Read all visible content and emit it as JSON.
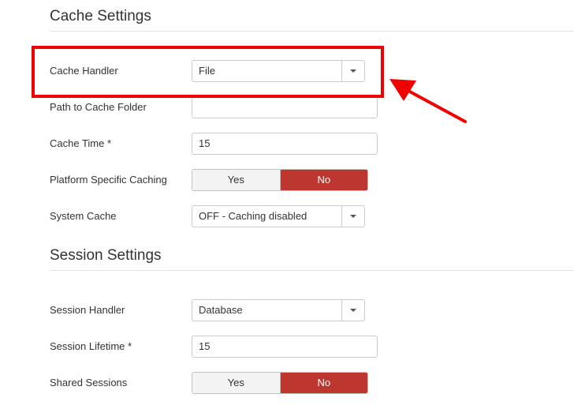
{
  "cache_section": {
    "title": "Cache Settings",
    "fields": {
      "handler": {
        "label": "Cache Handler",
        "value": "File"
      },
      "path": {
        "label": "Path to Cache Folder",
        "value": ""
      },
      "time": {
        "label": "Cache Time *",
        "value": "15"
      },
      "platform": {
        "label": "Platform Specific Caching",
        "yes": "Yes",
        "no": "No",
        "selected": "No"
      },
      "system": {
        "label": "System Cache",
        "value": "OFF - Caching disabled"
      }
    }
  },
  "session_section": {
    "title": "Session Settings",
    "fields": {
      "handler": {
        "label": "Session Handler",
        "value": "Database"
      },
      "lifetime": {
        "label": "Session Lifetime *",
        "value": "15"
      },
      "shared": {
        "label": "Shared Sessions",
        "yes": "Yes",
        "no": "No",
        "selected": "No"
      }
    }
  },
  "annotation": {
    "color": "#f00000"
  },
  "icons": {
    "caret": "chevron-down-icon",
    "arrow": "arrow-icon"
  },
  "colors": {
    "toggle_active": "#bd362f"
  }
}
